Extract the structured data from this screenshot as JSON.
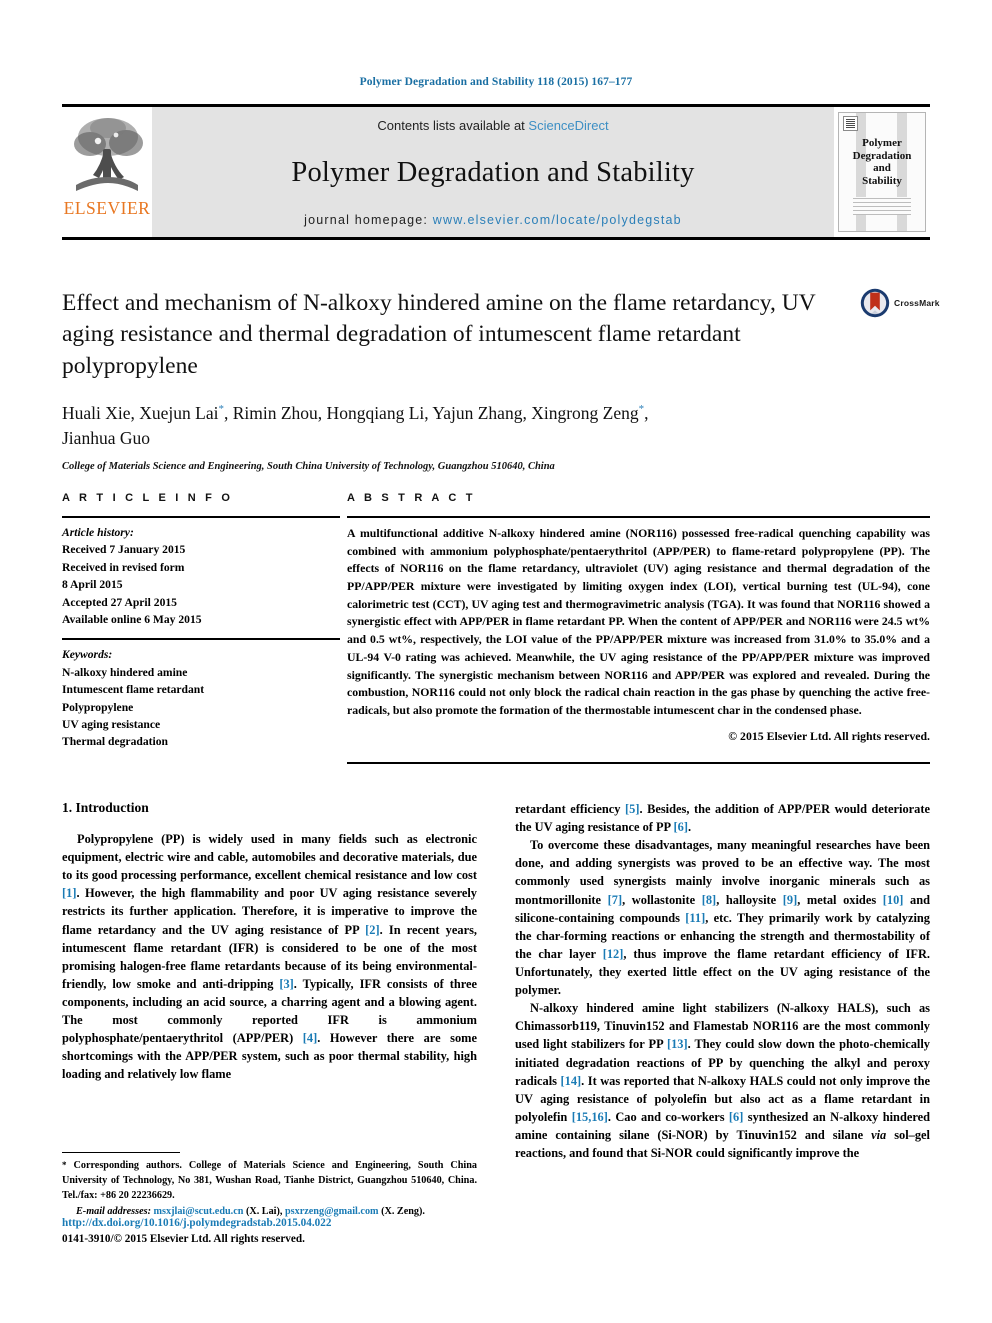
{
  "running_head": "Polymer Degradation and Stability 118 (2015) 167–177",
  "masthead": {
    "publisher_name": "ELSEVIER",
    "contents_prefix": "Contents lists available at ",
    "contents_link": "ScienceDirect",
    "journal_title": "Polymer Degradation and Stability",
    "homepage_prefix": "journal homepage: ",
    "homepage_url": "www.elsevier.com/locate/polydegstab",
    "cover_title": "Polymer\nDegradation\nand\nStability"
  },
  "crossmark": {
    "label": "CrossMark"
  },
  "article": {
    "title": "Effect and mechanism of N-alkoxy hindered amine on the flame retardancy, UV aging resistance and thermal degradation of intumescent flame retardant polypropylene",
    "authors_line1": "Huali Xie, Xuejun Lai",
    "authors_line1b": ", Rimin Zhou, Hongqiang Li, Yajun Zhang, Xingrong Zeng",
    "authors_line1c": ",",
    "authors_line2": "Jianhua Guo",
    "star": "*",
    "affiliation": "College of Materials Science and Engineering, South China University of Technology, Guangzhou 510640, China"
  },
  "article_info": {
    "heading": "A R T I C L E   I N F O",
    "history_label": "Article history:",
    "history": [
      "Received 7 January 2015",
      "Received in revised form",
      "8 April 2015",
      "Accepted 27 April 2015",
      "Available online 6 May 2015"
    ],
    "keywords_label": "Keywords:",
    "keywords": [
      "N-alkoxy hindered amine",
      "Intumescent flame retardant",
      "Polypropylene",
      "UV aging resistance",
      "Thermal degradation"
    ]
  },
  "abstract": {
    "heading": "A B S T R A C T",
    "text": "A multifunctional additive N-alkoxy hindered amine (NOR116) possessed free-radical quenching capability was combined with ammonium polyphosphate/pentaerythritol (APP/PER) to flame-retard polypropylene (PP). The effects of NOR116 on the flame retardancy, ultraviolet (UV) aging resistance and thermal degradation of the PP/APP/PER mixture were investigated by limiting oxygen index (LOI), vertical burning test (UL-94), cone calorimetric test (CCT), UV aging test and thermogravimetric analysis (TGA). It was found that NOR116 showed a synergistic effect with APP/PER in flame retardant PP. When the content of APP/PER and NOR116 were 24.5 wt% and 0.5 wt%, respectively, the LOI value of the PP/APP/PER mixture was increased from 31.0% to 35.0% and a UL-94 V-0 rating was achieved. Meanwhile, the UV aging resistance of the PP/APP/PER mixture was improved significantly. The synergistic mechanism between NOR116 and APP/PER was explored and revealed. During the combustion, NOR116 could not only block the radical chain reaction in the gas phase by quenching the active free-radicals, but also promote the formation of the thermostable intumescent char in the condensed phase.",
    "copyright": "© 2015 Elsevier Ltd. All rights reserved."
  },
  "section": {
    "number_title": "1. Introduction"
  },
  "body": {
    "p1_a": "Polypropylene (PP) is widely used in many fields such as electronic equipment, electric wire and cable, automobiles and decorative materials, due to its good processing performance, excellent chemical resistance and low cost ",
    "p1_r1": "[1]",
    "p1_b": ". However, the high flammability and poor UV aging resistance severely restricts its further application. Therefore, it is imperative to improve the flame retardancy and the UV aging resistance of PP ",
    "p1_r2": "[2]",
    "p1_c": ". In recent years, intumescent flame retardant (IFR) is considered to be one of the most promising halogen-free flame retardants because of its being environmental-friendly, low smoke and anti-dripping ",
    "p1_r3": "[3]",
    "p1_d": ". Typically, IFR consists of three components, including an acid source, a charring agent and a blowing agent. The most commonly reported IFR is ammonium polyphosphate/pentaerythritol (APP/PER) ",
    "p1_r4": "[4]",
    "p1_e": ". However there are some shortcomings with the APP/PER system, such as poor thermal stability, high loading and relatively low flame",
    "p2_a": "retardant efficiency ",
    "p2_r5": "[5]",
    "p2_b": ". Besides, the addition of APP/PER would deteriorate the UV aging resistance of PP ",
    "p2_r6": "[6]",
    "p2_c": ".",
    "p3_a": "To overcome these disadvantages, many meaningful researches have been done, and adding synergists was proved to be an effective way. The most commonly used synergists mainly involve inorganic minerals such as montmorillonite ",
    "p3_r7": "[7]",
    "p3_b": ", wollastonite ",
    "p3_r8": "[8]",
    "p3_c": ", halloysite ",
    "p3_r9": "[9]",
    "p3_d": ", metal oxides ",
    "p3_r10": "[10]",
    "p3_e": " and silicone-containing compounds ",
    "p3_r11": "[11]",
    "p3_f": ", etc. They primarily work by catalyzing the char-forming reactions or enhancing the strength and thermostability of the char layer ",
    "p3_r12": "[12]",
    "p3_g": ", thus improve the flame retardant efficiency of IFR. Unfortunately, they exerted little effect on the UV aging resistance of the polymer.",
    "p4_a": "N-alkoxy hindered amine light stabilizers (N-alkoxy HALS), such as Chimassorb119, Tinuvin152 and Flamestab NOR116 are the most commonly used light stabilizers for PP ",
    "p4_r13": "[13]",
    "p4_b": ". They could slow down the photo-chemically initiated degradation reactions of PP by quenching the alkyl and peroxy radicals ",
    "p4_r14": "[14]",
    "p4_c": ". It was reported that N-alkoxy HALS could not only improve the UV aging resistance of polyolefin but also act as a flame retardant in polyolefin ",
    "p4_r15": "[15,16]",
    "p4_d": ". Cao and co-workers ",
    "p4_r6b": "[6]",
    "p4_e": " synthesized an N-alkoxy hindered amine containing silane (Si-NOR) by Tinuvin152 and silane ",
    "p4_via": "via",
    "p4_f": " sol–gel reactions, and found that Si-NOR could significantly improve the"
  },
  "footnote": {
    "star": "*",
    "text": " Corresponding authors. College of Materials Science and Engineering, South China University of Technology, No 381, Wushan Road, Tianhe District, Guangzhou 510640, China. Tel./fax: +86 20 22236629.",
    "email_label": "E-mail addresses:",
    "email1": "msxjlai@scut.edu.cn",
    "email1_who": " (X. Lai), ",
    "email2": "psxrzeng@gmail.com",
    "email2_who": " (X. Zeng)."
  },
  "doi": {
    "url": "http://dx.doi.org/10.1016/j.polymdegradstab.2015.04.022",
    "issn_line": "0141-3910/© 2015 Elsevier Ltd. All rights reserved."
  },
  "colors": {
    "link_blue": "#1a7bb5",
    "header_blue": "#1a6fa3",
    "elsevier_orange": "#E87722",
    "masthead_grey": "#e3e3e3"
  }
}
